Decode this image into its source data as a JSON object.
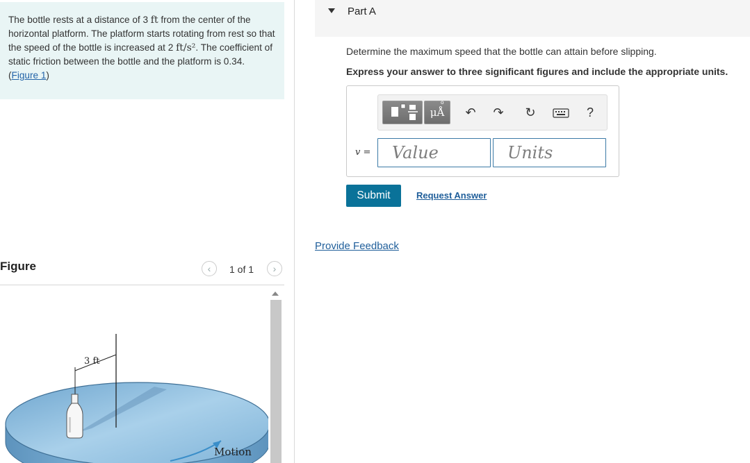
{
  "problem": {
    "text_before_ft1": "The bottle rests at a distance of 3 ",
    "unit_ft": "ft",
    "text_after_ft1": " from the center of the horizontal platform. The platform starts rotating from rest so that the speed of the bottle is increased at 2 ",
    "unit_acc": "ft/s²",
    "text_after_acc": ". The coefficient of static friction between the bottle and the platform is 0.34.",
    "figure_link_open": "(",
    "figure_link": "Figure 1",
    "figure_link_close": ")"
  },
  "figure": {
    "title": "Figure",
    "pager": "1 of 1",
    "prev_icon": "chevron-left-icon",
    "next_icon": "chevron-right-icon",
    "dimension_label": "3 ft",
    "motion_label": "Motion"
  },
  "part": {
    "title": "Part A",
    "question": "Determine the maximum speed that the bottle can attain before slipping.",
    "instruction": "Express your answer to three significant figures and include the appropriate units."
  },
  "answer": {
    "toolbar": {
      "units_button": "μÅ",
      "units_ring": "o",
      "help": "?",
      "icons": [
        "templates-icon",
        "units-icon",
        "undo-icon",
        "redo-icon",
        "reset-icon",
        "keyboard-icon",
        "help-icon"
      ]
    },
    "variable_label": "v =",
    "value_placeholder": "Value",
    "units_placeholder": "Units"
  },
  "actions": {
    "submit": "Submit",
    "request_answer": "Request Answer",
    "provide_feedback": "Provide Feedback"
  },
  "colors": {
    "problem_bg": "#e9f5f5",
    "submit_bg": "#0a7299",
    "link": "#1f5e9a",
    "platform": "#8fbfe0"
  }
}
